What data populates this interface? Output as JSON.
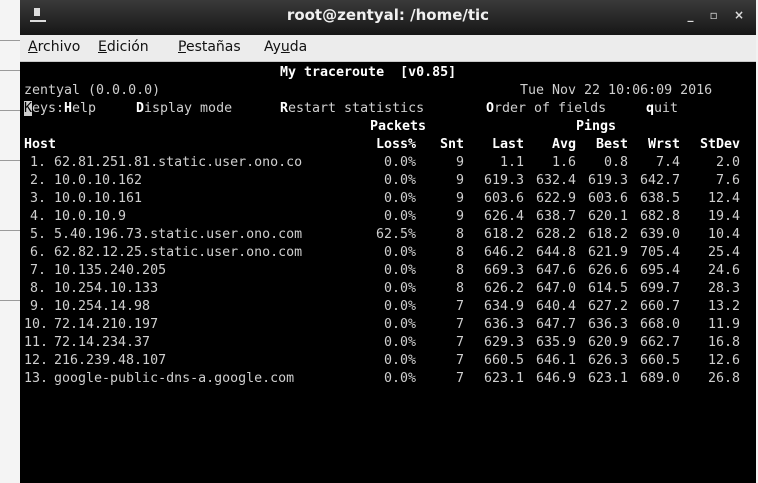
{
  "window": {
    "title": "root@zentyal: /home/tic",
    "controls": "_ ▫ ×"
  },
  "menu": [
    {
      "label": "Archivo",
      "acc": "A",
      "rest": "rchivo",
      "pre": ""
    },
    {
      "label": "Edición",
      "acc": "E",
      "rest": "dición",
      "pre": ""
    },
    {
      "label": "Pestañas",
      "acc": "P",
      "rest": "estañas",
      "pre": ""
    },
    {
      "label": "Ayuda",
      "acc": "u",
      "rest": "da",
      "pre": "Ay"
    }
  ],
  "mtr": {
    "header": "My traceroute  [v0.85]",
    "host_line": "zentyal (0.0.0.0)",
    "datetime": "Tue Nov 22 10:06:09 2016",
    "keys": {
      "label_k": "K",
      "label_rest": "eys:",
      "items": [
        {
          "key": "H",
          "rest": "elp"
        },
        {
          "key": "D",
          "rest": "isplay mode"
        },
        {
          "key": "R",
          "rest": "estart statistics"
        },
        {
          "key": "O",
          "rest": "rder of fields"
        },
        {
          "key": "q",
          "rest": "uit"
        }
      ]
    },
    "group_packets": "Packets",
    "group_pings": "Pings",
    "columns": {
      "host": "Host",
      "loss": "Loss%",
      "snt": "Snt",
      "last": "Last",
      "avg": "Avg",
      "best": "Best",
      "wrst": "Wrst",
      "stdev": "StDev"
    },
    "rows": [
      {
        "n": "1.",
        "host": "62.81.251.81.static.user.ono.co",
        "loss": "0.0%",
        "snt": "9",
        "last": "1.1",
        "avg": "1.6",
        "best": "0.8",
        "wrst": "7.4",
        "stdev": "2.0"
      },
      {
        "n": "2.",
        "host": "10.0.10.162",
        "loss": "0.0%",
        "snt": "9",
        "last": "619.3",
        "avg": "632.4",
        "best": "619.3",
        "wrst": "642.7",
        "stdev": "7.6"
      },
      {
        "n": "3.",
        "host": "10.0.10.161",
        "loss": "0.0%",
        "snt": "9",
        "last": "603.6",
        "avg": "622.9",
        "best": "603.6",
        "wrst": "638.5",
        "stdev": "12.4"
      },
      {
        "n": "4.",
        "host": "10.0.10.9",
        "loss": "0.0%",
        "snt": "9",
        "last": "626.4",
        "avg": "638.7",
        "best": "620.1",
        "wrst": "682.8",
        "stdev": "19.4"
      },
      {
        "n": "5.",
        "host": "5.40.196.73.static.user.ono.com",
        "loss": "62.5%",
        "snt": "8",
        "last": "618.2",
        "avg": "628.2",
        "best": "618.2",
        "wrst": "639.0",
        "stdev": "10.4"
      },
      {
        "n": "6.",
        "host": "62.82.12.25.static.user.ono.com",
        "loss": "0.0%",
        "snt": "8",
        "last": "646.2",
        "avg": "644.8",
        "best": "621.9",
        "wrst": "705.4",
        "stdev": "25.4"
      },
      {
        "n": "7.",
        "host": "10.135.240.205",
        "loss": "0.0%",
        "snt": "8",
        "last": "669.3",
        "avg": "647.6",
        "best": "626.6",
        "wrst": "695.4",
        "stdev": "24.6"
      },
      {
        "n": "8.",
        "host": "10.254.10.133",
        "loss": "0.0%",
        "snt": "8",
        "last": "626.2",
        "avg": "647.0",
        "best": "614.5",
        "wrst": "699.7",
        "stdev": "28.3"
      },
      {
        "n": "9.",
        "host": "10.254.14.98",
        "loss": "0.0%",
        "snt": "7",
        "last": "634.9",
        "avg": "640.4",
        "best": "627.2",
        "wrst": "660.7",
        "stdev": "13.2"
      },
      {
        "n": "10.",
        "host": "72.14.210.197",
        "loss": "0.0%",
        "snt": "7",
        "last": "636.3",
        "avg": "647.7",
        "best": "636.3",
        "wrst": "668.0",
        "stdev": "11.9"
      },
      {
        "n": "11.",
        "host": "72.14.234.37",
        "loss": "0.0%",
        "snt": "7",
        "last": "629.3",
        "avg": "635.9",
        "best": "620.9",
        "wrst": "662.7",
        "stdev": "16.8"
      },
      {
        "n": "12.",
        "host": "216.239.48.107",
        "loss": "0.0%",
        "snt": "7",
        "last": "660.5",
        "avg": "646.1",
        "best": "626.3",
        "wrst": "660.5",
        "stdev": "12.6"
      },
      {
        "n": "13.",
        "host": "google-public-dns-a.google.com",
        "loss": "0.0%",
        "snt": "7",
        "last": "623.1",
        "avg": "646.9",
        "best": "623.1",
        "wrst": "689.0",
        "stdev": "26.8"
      }
    ]
  }
}
